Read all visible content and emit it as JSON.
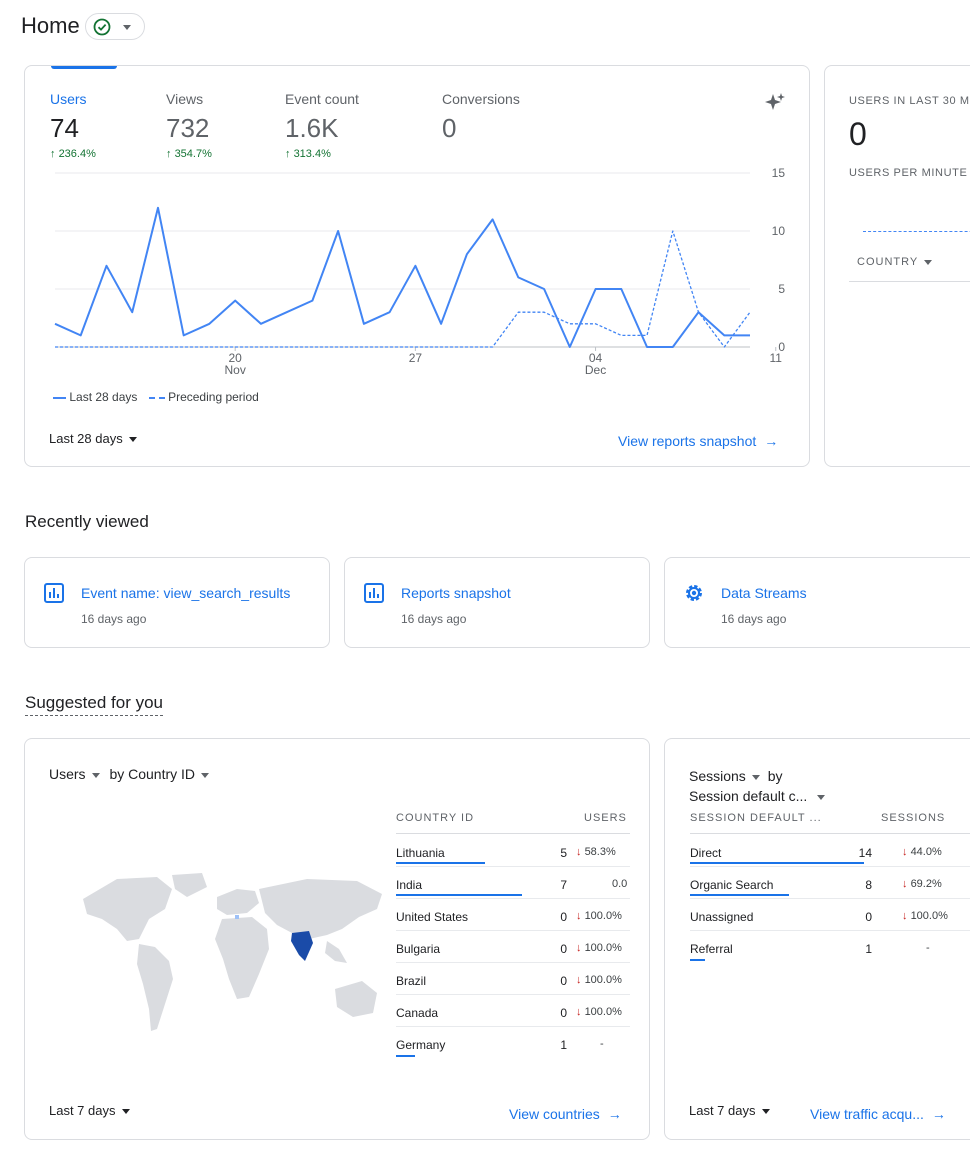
{
  "header": {
    "title": "Home"
  },
  "overview": {
    "metrics": [
      {
        "label": "Users",
        "value": "74",
        "change": "236.4%",
        "active": true
      },
      {
        "label": "Views",
        "value": "732",
        "change": "354.7%",
        "active": false
      },
      {
        "label": "Event count",
        "value": "1.6K",
        "change": "313.4%",
        "active": false
      },
      {
        "label": "Conversions",
        "value": "0",
        "change": "",
        "active": false
      }
    ],
    "legend": {
      "current": "Last 28 days",
      "previous": "Preceding period"
    },
    "date_range": "Last 28 days",
    "view_link": "View reports snapshot"
  },
  "chart_data": {
    "type": "line",
    "title": "",
    "xlabel": "",
    "ylabel": "",
    "ylim": [
      0,
      15
    ],
    "y_ticks": [
      "0",
      "5",
      "10",
      "15"
    ],
    "x_ticks": [
      {
        "index": 7,
        "label": "20",
        "sub": "Nov"
      },
      {
        "index": 14,
        "label": "27",
        "sub": ""
      },
      {
        "index": 21,
        "label": "04",
        "sub": "Dec"
      },
      {
        "index": 28,
        "label": "11",
        "sub": ""
      }
    ],
    "series": [
      {
        "name": "Last 28 days",
        "style": "solid",
        "values": [
          2,
          1,
          7,
          3,
          12,
          1,
          2,
          4,
          2,
          3,
          4,
          10,
          2,
          3,
          7,
          2,
          8,
          11,
          6,
          5,
          0,
          5,
          5,
          0,
          0,
          3,
          1,
          1
        ]
      },
      {
        "name": "Preceding period",
        "style": "dashed",
        "values": [
          0,
          0,
          0,
          0,
          0,
          0,
          0,
          0,
          0,
          0,
          0,
          0,
          0,
          0,
          0,
          0,
          0,
          0,
          3,
          3,
          2,
          2,
          1,
          1,
          10,
          3,
          0,
          3
        ]
      }
    ],
    "grid": true,
    "legend_position": "bottom-left"
  },
  "realtime": {
    "users_label": "USERS IN LAST 30 M",
    "users_value": "0",
    "per_minute_label": "USERS PER MINUTE",
    "country_label": "COUNTRY"
  },
  "recently_viewed": {
    "heading": "Recently viewed",
    "items": [
      {
        "title": "Event name: view_search_results",
        "time": "16 days ago",
        "icon": "bar-chart-icon"
      },
      {
        "title": "Reports snapshot",
        "time": "16 days ago",
        "icon": "bar-chart-icon"
      },
      {
        "title": "Data Streams",
        "time": "16 days ago",
        "icon": "gear-icon"
      }
    ]
  },
  "suggested": {
    "heading": "Suggested for you",
    "country_card": {
      "metric": "Users",
      "by": "by Country ID",
      "col1": "COUNTRY ID",
      "col2": "USERS",
      "rows": [
        {
          "name": "Lithuania",
          "value": "5",
          "change": "58.3%",
          "dir": "down",
          "bar": 0.38
        },
        {
          "name": "India",
          "value": "7",
          "change": "0.0",
          "dir": "",
          "bar": 0.54
        },
        {
          "name": "United States",
          "value": "0",
          "change": "100.0%",
          "dir": "down",
          "bar": 0
        },
        {
          "name": "Bulgaria",
          "value": "0",
          "change": "100.0%",
          "dir": "down",
          "bar": 0
        },
        {
          "name": "Brazil",
          "value": "0",
          "change": "100.0%",
          "dir": "down",
          "bar": 0
        },
        {
          "name": "Canada",
          "value": "0",
          "change": "100.0%",
          "dir": "down",
          "bar": 0
        },
        {
          "name": "Germany",
          "value": "1",
          "change": "-",
          "dir": "",
          "bar": 0.08
        }
      ],
      "date_range": "Last 7 days",
      "link": "View countries"
    },
    "sessions_card": {
      "metric": "Sessions",
      "by": "by",
      "dimension": "Session default c...",
      "col1": "SESSION DEFAULT ...",
      "col2": "SESSIONS",
      "rows": [
        {
          "name": "Direct",
          "value": "14",
          "change": "44.0%",
          "dir": "down",
          "bar": 0.6
        },
        {
          "name": "Organic Search",
          "value": "8",
          "change": "69.2%",
          "dir": "down",
          "bar": 0.34
        },
        {
          "name": "Unassigned",
          "value": "0",
          "change": "100.0%",
          "dir": "down",
          "bar": 0
        },
        {
          "name": "Referral",
          "value": "1",
          "change": "-",
          "dir": "",
          "bar": 0.05
        }
      ],
      "date_range": "Last 7 days",
      "link": "View traffic acqu..."
    }
  }
}
